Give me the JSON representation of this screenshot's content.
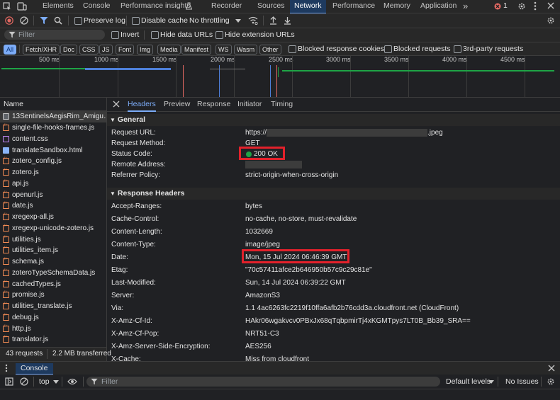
{
  "topbar": {
    "tabs": [
      "Elements",
      "Console",
      "Performance insights",
      "Recorder",
      "Sources",
      "Network",
      "Performance",
      "Memory",
      "Application"
    ],
    "error_count": "1",
    "more_tabs": "»"
  },
  "toolbar": {
    "preserve_log": "Preserve log",
    "disable_cache": "Disable cache",
    "throttling": "No throttling"
  },
  "filterbar": {
    "placeholder": "Filter",
    "invert": "Invert",
    "hide_data_urls": "Hide data URLs",
    "hide_extension_urls": "Hide extension URLs"
  },
  "typebar": {
    "types": [
      "All",
      "Fetch/XHR",
      "Doc",
      "CSS",
      "JS",
      "Font",
      "Img",
      "Media",
      "Manifest",
      "WS",
      "Wasm",
      "Other"
    ],
    "blocked_cookies": "Blocked response cookies",
    "blocked_requests": "Blocked requests",
    "third_party": "3rd-party requests"
  },
  "overview": {
    "ticks": [
      "500 ms",
      "1000 ms",
      "1500 ms",
      "2000 ms",
      "2500 ms",
      "3000 ms",
      "3500 ms",
      "4000 ms",
      "4500 ms"
    ]
  },
  "requests": {
    "header": "Name",
    "files": [
      {
        "name": "13SentinelsAegisRim_Amigu…",
        "type": "img"
      },
      {
        "name": "single-file-hooks-frames.js",
        "type": "js"
      },
      {
        "name": "content.css",
        "type": "css"
      },
      {
        "name": "translateSandbox.html",
        "type": "html"
      },
      {
        "name": "zotero_config.js",
        "type": "js"
      },
      {
        "name": "zotero.js",
        "type": "js"
      },
      {
        "name": "api.js",
        "type": "js"
      },
      {
        "name": "openurl.js",
        "type": "js"
      },
      {
        "name": "date.js",
        "type": "js"
      },
      {
        "name": "xregexp-all.js",
        "type": "js"
      },
      {
        "name": "xregexp-unicode-zotero.js",
        "type": "js"
      },
      {
        "name": "utilities.js",
        "type": "js"
      },
      {
        "name": "utilities_item.js",
        "type": "js"
      },
      {
        "name": "schema.js",
        "type": "js"
      },
      {
        "name": "zoteroTypeSchemaData.js",
        "type": "js"
      },
      {
        "name": "cachedTypes.js",
        "type": "js"
      },
      {
        "name": "promise.js",
        "type": "js"
      },
      {
        "name": "utilities_translate.js",
        "type": "js"
      },
      {
        "name": "debug.js",
        "type": "js"
      },
      {
        "name": "http.js",
        "type": "js"
      },
      {
        "name": "translator.js",
        "type": "js"
      }
    ],
    "count": "43 requests",
    "transferred": "2.2 MB transferred"
  },
  "details": {
    "tabs": [
      "Headers",
      "Preview",
      "Response",
      "Initiator",
      "Timing"
    ],
    "general_title": "General",
    "general": [
      {
        "key": "Request URL:",
        "value": "https://",
        "suffix": ".jpeg"
      },
      {
        "key": "Request Method:",
        "value": "GET"
      },
      {
        "key": "Status Code:",
        "value": "200 OK"
      },
      {
        "key": "Remote Address:",
        "value": ""
      },
      {
        "key": "Referrer Policy:",
        "value": "strict-origin-when-cross-origin"
      }
    ],
    "response_title": "Response Headers",
    "response": [
      {
        "key": "Accept-Ranges:",
        "value": "bytes"
      },
      {
        "key": "Cache-Control:",
        "value": "no-cache, no-store, must-revalidate"
      },
      {
        "key": "Content-Length:",
        "value": "1032669"
      },
      {
        "key": "Content-Type:",
        "value": "image/jpeg"
      },
      {
        "key": "Date:",
        "value": "Mon, 15 Jul 2024 06:46:39 GMT"
      },
      {
        "key": "Etag:",
        "value": "\"70c57411afce2b646950b57c9c29c81e\""
      },
      {
        "key": "Last-Modified:",
        "value": "Sun, 14 Jul 2024 06:39:22 GMT"
      },
      {
        "key": "Server:",
        "value": "AmazonS3"
      },
      {
        "key": "Via:",
        "value": "1.1 4ac6263fc2219f10ffa6afb2b76cdd3a.cloudfront.net (CloudFront)"
      },
      {
        "key": "X-Amz-Cf-Id:",
        "value": "HAkr06wgakvcv0PBxJx68qTqbpmirTj4xKGMTpys7LT0B_Bb39_SRA=="
      },
      {
        "key": "X-Amz-Cf-Pop:",
        "value": "NRT51-C3"
      },
      {
        "key": "X-Amz-Server-Side-Encryption:",
        "value": "AES256"
      },
      {
        "key": "X-Cache:",
        "value": "Miss from cloudfront"
      }
    ]
  },
  "drawer": {
    "tab": "Console",
    "context": "top",
    "filter_placeholder": "Filter",
    "levels": "Default levels",
    "issues": "No Issues"
  },
  "colors": {
    "accent": "#7cacf8",
    "status_ok": "#1ea446",
    "highlight_box": "#e3212b"
  }
}
